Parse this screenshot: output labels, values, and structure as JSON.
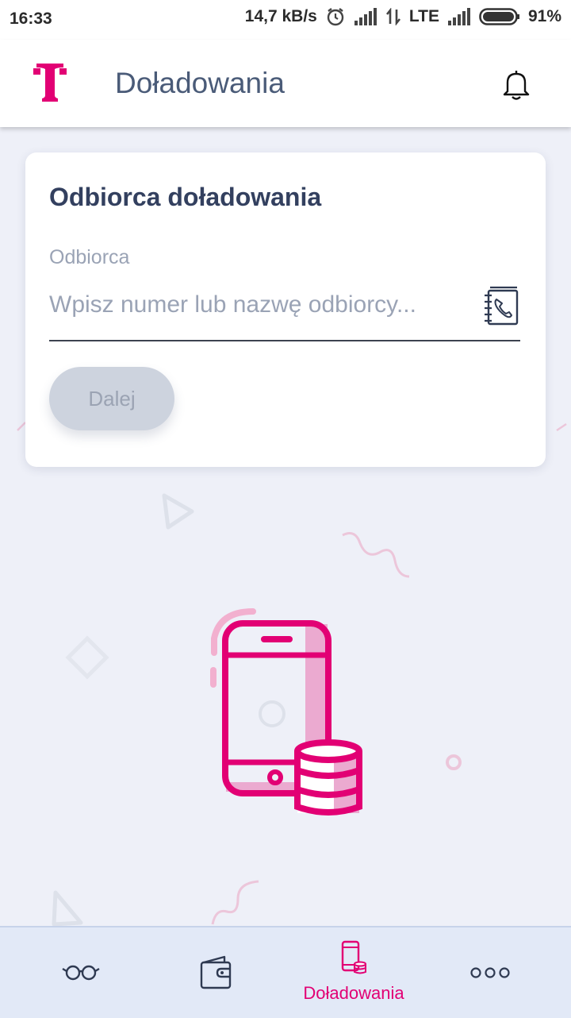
{
  "status_bar": {
    "time": "16:33",
    "speed": "14,7 kB/s",
    "network": "LTE",
    "battery": "91%"
  },
  "header": {
    "title": "Doładowania",
    "logo_icon": "telekom-t-logo",
    "bell_icon": "bell-icon",
    "brand_color": "#e20074"
  },
  "card": {
    "title": "Odbiorca doładowania",
    "field_label": "Odbiorca",
    "input_value": "",
    "input_placeholder": "Wpisz numer lub nazwę odbiorcy...",
    "contacts_icon": "contacts-book-icon",
    "next_button": "Dalej"
  },
  "bottom_nav": {
    "items": [
      {
        "icon": "glasses-icon",
        "label": ""
      },
      {
        "icon": "wallet-icon",
        "label": ""
      },
      {
        "icon": "phone-topup-icon",
        "label": "Doładowania",
        "active": true
      },
      {
        "icon": "more-dots-icon",
        "label": ""
      }
    ]
  }
}
